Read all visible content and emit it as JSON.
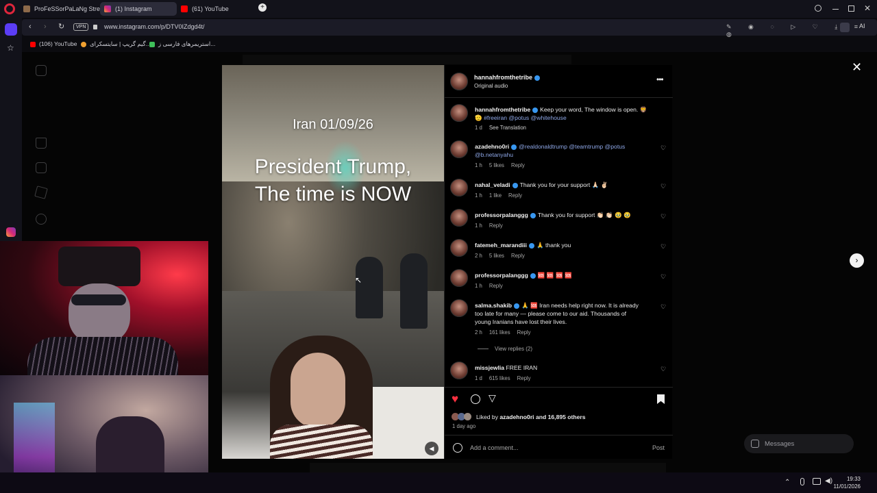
{
  "browser": {
    "tabs": [
      {
        "label": "ProFeSSorPaLaNg Stream"
      },
      {
        "label": "(1) Instagram"
      },
      {
        "label": "(61) YouTube"
      }
    ],
    "url": "www.instagram.com/p/DTV0IZdgd4t/",
    "vpn_label": "VPN",
    "ai_label": "AI",
    "bookmarks": [
      {
        "label": "(106) YouTube"
      },
      {
        "label": "گیم گریپ | سایتسکرای..."
      },
      {
        "label": "استریمرهای فارسی ز..."
      }
    ]
  },
  "post": {
    "author": "hannahfromthetribe",
    "audio": "Original audio",
    "media": {
      "caption_date": "Iran 01/09/26",
      "caption_line1": "President Trump,",
      "caption_line2": "The time is NOW"
    },
    "caption": {
      "user": "hannahfromthetribe",
      "text": "Keep your word, The window is open. 🦁",
      "emoji": "🫡",
      "tags": "#freeiran @potus @whitehouse",
      "time": "1 d",
      "translate": "See Translation"
    },
    "comments": [
      {
        "user": "azadehno0ri",
        "text": "@realdonaldtrump @teamtrump @potus @b.netanyahu",
        "time": "1 h",
        "likes": "5 likes",
        "reply": "Reply"
      },
      {
        "user": "nahal_veladi",
        "text": "Thank you for your support 🙏🏻 ✌🏻",
        "time": "1 h",
        "likes": "1 like",
        "reply": "Reply"
      },
      {
        "user": "professorpalanggg",
        "text": "Thank you for support 👏🏻 👏🏻 🥹 🥹",
        "time": "1 h",
        "likes": "",
        "reply": "Reply"
      },
      {
        "user": "fatemeh_marandiii",
        "text": "🙏 thank you",
        "time": "2 h",
        "likes": "5 likes",
        "reply": "Reply"
      },
      {
        "user": "professorpalanggg",
        "text": "🆘 🆘 🆘 🆘",
        "time": "1 h",
        "likes": "",
        "reply": "Reply"
      },
      {
        "user": "salma.shakib",
        "text": "🙏 🆘 Iran needs help right now. It is already too late for many — please come to our aid. Thousands of young Iranians have lost their lives.",
        "time": "2 h",
        "likes": "161 likes",
        "reply": "Reply"
      },
      {
        "user": "missjewlia",
        "text": "FREE IRAN",
        "time": "1 d",
        "likes": "615 likes",
        "reply": "Reply"
      }
    ],
    "view_replies": "View replies (2)",
    "liked_by_prefix": "Liked by",
    "liked_by_user": "azadehno0ri",
    "liked_by_suffix": "and 16,895 others",
    "posted": "1 day ago",
    "add_comment_placeholder": "Add a comment...",
    "post_button": "Post"
  },
  "messages_label": "Messages",
  "clock": {
    "time": "19:33",
    "date": "11/01/2026"
  },
  "colors": {
    "heart_red": "#ff3040",
    "verified_blue": "#3897f0",
    "link_blue": "#8fa8e8"
  }
}
